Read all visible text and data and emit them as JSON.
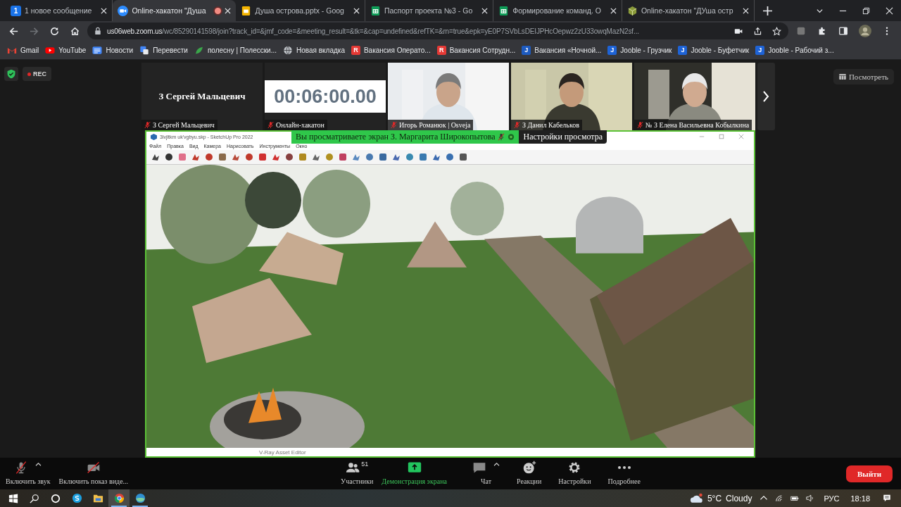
{
  "tabs": [
    {
      "badge": "1",
      "title": "1 новое сообщение",
      "selected": false,
      "recording": false
    },
    {
      "title": "Online-хакатон \"Душа",
      "selected": true,
      "recording": true
    },
    {
      "title": "Душа острова.pptx - Goog",
      "selected": false,
      "recording": false
    },
    {
      "title": "Паспорт проекта №3 - Go",
      "selected": false,
      "recording": false
    },
    {
      "title": "Формирование команд. О",
      "selected": false,
      "recording": false
    },
    {
      "title": "Online-хакатон \"ДУша остр",
      "selected": false,
      "recording": false
    }
  ],
  "nav": [
    {
      "kind": "back",
      "disabled": false
    },
    {
      "kind": "forward",
      "disabled": true
    },
    {
      "kind": "reload",
      "disabled": false
    },
    {
      "kind": "home",
      "disabled": false
    }
  ],
  "address": {
    "host": "us06web.zoom.us",
    "path": "/wc/85290141598/join?track_id=&jmf_code=&meeting_result=&tk=&cap=undefined&refTK=&rn=true&epk=yE0P7SVbLsDEIJPHcOepwz2zU33owqMazN2sf..."
  },
  "bookmarks": [
    {
      "label": "Gmail"
    },
    {
      "label": "YouTube"
    },
    {
      "label": "Новости"
    },
    {
      "label": "Перевести"
    },
    {
      "label": "полесну | Полесски..."
    },
    {
      "label": "Новая вкладка"
    },
    {
      "badge": "R",
      "color": "#e53935",
      "label": "Вакансия Операто..."
    },
    {
      "badge": "R",
      "color": "#e53935",
      "label": "Вакансия Сотрудн..."
    },
    {
      "badge": "J",
      "color": "#1e5bbf",
      "label": "Вакансия «Ночной..."
    },
    {
      "badge": "J",
      "color": "#1e63d6",
      "label": "Jooble - Грузчик"
    },
    {
      "badge": "J",
      "color": "#1e63d6",
      "label": "Jooble - Буфетчик"
    },
    {
      "badge": "J",
      "color": "#1e63d6",
      "label": "Jooble - Рабочий з..."
    }
  ],
  "meeting": {
    "rec": "REC",
    "view_button": "Посмотреть",
    "tiles": [
      {
        "kind": "name",
        "name": "З Сергей Мальцевич",
        "label": "З Сергей Мальцевич",
        "muted": true
      },
      {
        "kind": "timer",
        "timer": "00:06:00.00",
        "label": "Онлайн-хакатон",
        "muted": true
      },
      {
        "kind": "video",
        "label": "Игорь Романюк | Osveja",
        "muted": true
      },
      {
        "kind": "video",
        "label": "З Данил Кабельков",
        "muted": true
      },
      {
        "kind": "video",
        "label": "№ З Елена Васильевна Кобылкина",
        "muted": true
      }
    ],
    "share": {
      "banner": "Вы просматриваете экран З. Маргарита Широкопытова",
      "presenter_muted": true,
      "options": "Настройки просмотра",
      "app": {
        "title": "3lvjltkm uk'vgbyu.skp - SketchUp Pro 2022",
        "menu": [
          "Файл",
          "Правка",
          "Вид",
          "Камера",
          "Нарисовать",
          "Инструменты",
          "Окно"
        ],
        "status": "V-Ray Asset Editor"
      }
    }
  },
  "toolbar": [
    {
      "kind": "audio",
      "label": "Включить звук",
      "off": true,
      "caret": true
    },
    {
      "kind": "video",
      "label": "Включить показ виде...",
      "off": true,
      "caret": false
    },
    {
      "kind": "participants",
      "label": "Участники",
      "count": "51",
      "caret": false
    },
    {
      "kind": "share",
      "label": "Демонстрация экрана",
      "caret": false
    },
    {
      "kind": "chat",
      "label": "Чат",
      "caret": true
    },
    {
      "kind": "reactions",
      "label": "Реакции",
      "caret": false
    },
    {
      "kind": "settings",
      "label": "Настройки",
      "caret": false
    },
    {
      "kind": "more",
      "label": "Подробнее",
      "caret": false
    }
  ],
  "leave": "Выйти",
  "taskbar": {
    "apps": [
      {
        "kind": "skype",
        "selected": false,
        "running": false
      },
      {
        "kind": "explorer",
        "selected": false,
        "running": false
      },
      {
        "kind": "chrome",
        "selected": true,
        "running": true
      },
      {
        "kind": "app",
        "selected": false,
        "running": true
      }
    ],
    "weather": {
      "temp": "5°C",
      "condition": "Cloudy"
    },
    "lang": "РУС",
    "time": "18:18"
  }
}
